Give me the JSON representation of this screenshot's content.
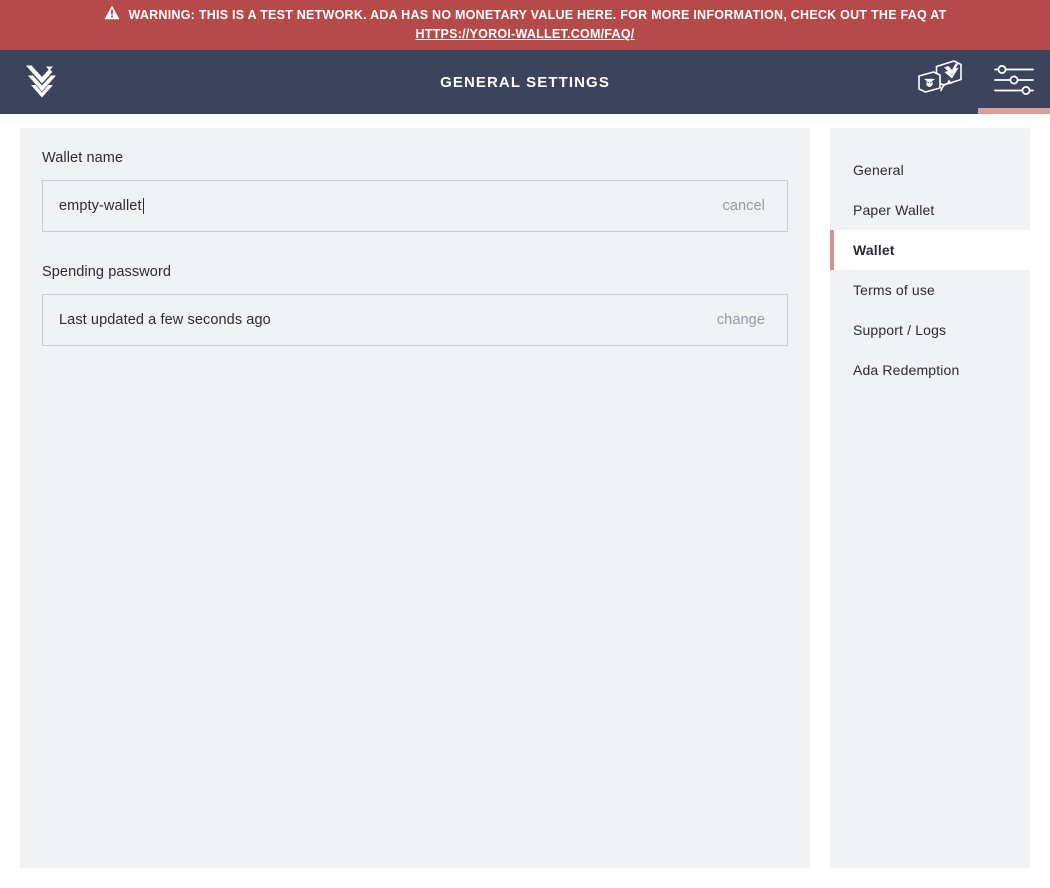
{
  "banner": {
    "icon": "warning-triangle-icon",
    "text": "WARNING: THIS IS A TEST NETWORK. ADA HAS NO MONETARY VALUE HERE. FOR MORE INFORMATION, CHECK OUT THE FAQ AT",
    "link": "HTTPS://YOROI-WALLET.COM/FAQ/",
    "background": "#b54a4a",
    "text_color": "#ffffff"
  },
  "topbar": {
    "logo": "yoroi-chevron-logo-icon",
    "title": "GENERAL SETTINGS",
    "background": "#3b445c",
    "wallet_switch_icon": "wallet-switch-icon",
    "settings_icon": "settings-sliders-icon",
    "active_indicator_color": "#d9a09a"
  },
  "main": {
    "wallet_name": {
      "label": "Wallet name",
      "value": "empty-wallet",
      "placeholder": "Wallet name",
      "action": "cancel"
    },
    "spending_password": {
      "label": "Spending password",
      "status": "Last updated a few seconds ago",
      "action": "change"
    }
  },
  "sidebar": {
    "active_accent": "#d2948d",
    "items": [
      {
        "label": "General",
        "active": false
      },
      {
        "label": "Paper Wallet",
        "active": false
      },
      {
        "label": "Wallet",
        "active": true
      },
      {
        "label": "Terms of use",
        "active": false
      },
      {
        "label": "Support / Logs",
        "active": false
      },
      {
        "label": "Ada Redemption",
        "active": false
      }
    ]
  }
}
